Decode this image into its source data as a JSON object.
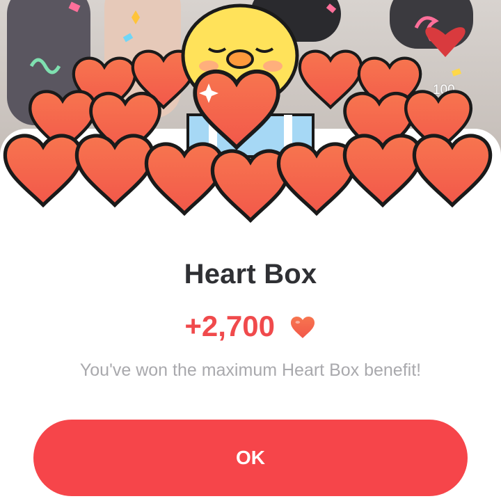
{
  "background": {
    "heart_count": "100"
  },
  "dialog": {
    "title": "Heart Box",
    "reward_amount": "+2,700",
    "description": "You've won the maximum Heart Box benefit!",
    "ok_label": "OK"
  },
  "colors": {
    "accent": "#f6454a",
    "reward_text": "#f04a4c",
    "title_text": "#2f3034",
    "description_text": "#a9a9ad",
    "heart_fill": "#f56b4e",
    "mascot_yellow": "#ffe25a"
  },
  "icons": [
    "heart-icon",
    "mascot-chick-illustration",
    "confetti-decoration"
  ]
}
